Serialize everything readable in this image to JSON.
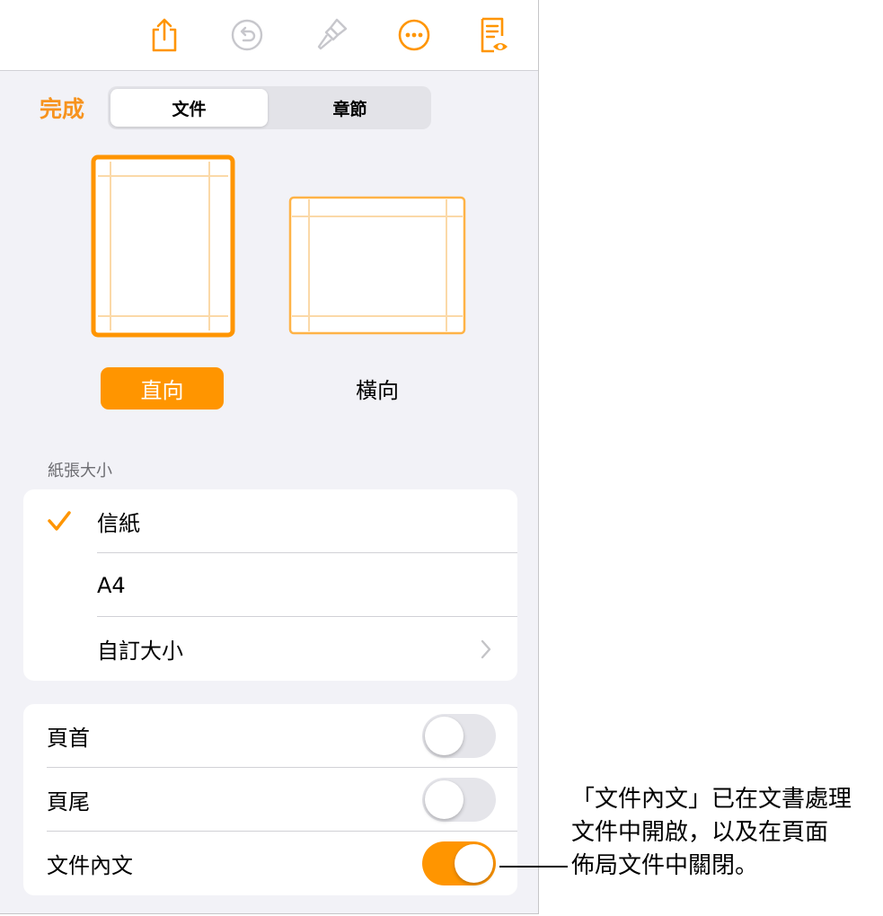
{
  "colors": {
    "accent": "#ff9500",
    "done_text": "#f7931e",
    "panel_bg": "#f2f2f7",
    "toggle_off": "#e5e5ea"
  },
  "toolbar": {
    "icons": [
      "share-icon",
      "undo-icon",
      "paintbrush-icon",
      "more-icon",
      "document-setup-icon"
    ]
  },
  "header": {
    "done_label": "完成",
    "tabs": [
      {
        "label": "文件",
        "selected": true
      },
      {
        "label": "章節",
        "selected": false
      }
    ]
  },
  "orientation": {
    "options": [
      {
        "label": "直向",
        "selected": true
      },
      {
        "label": "橫向",
        "selected": false
      }
    ]
  },
  "paper_size": {
    "header": "紙張大小",
    "items": [
      {
        "label": "信紙",
        "checked": true
      },
      {
        "label": "A4",
        "checked": false
      },
      {
        "label": "自訂大小",
        "checked": false,
        "disclosure": true
      }
    ]
  },
  "toggles": [
    {
      "label": "頁首",
      "on": false
    },
    {
      "label": "頁尾",
      "on": false
    },
    {
      "label": "文件內文",
      "on": true
    }
  ],
  "callout": {
    "lines": [
      "「文件內文」已在文書處理",
      "文件中開啟，以及在頁面",
      "佈局文件中關閉。"
    ]
  }
}
